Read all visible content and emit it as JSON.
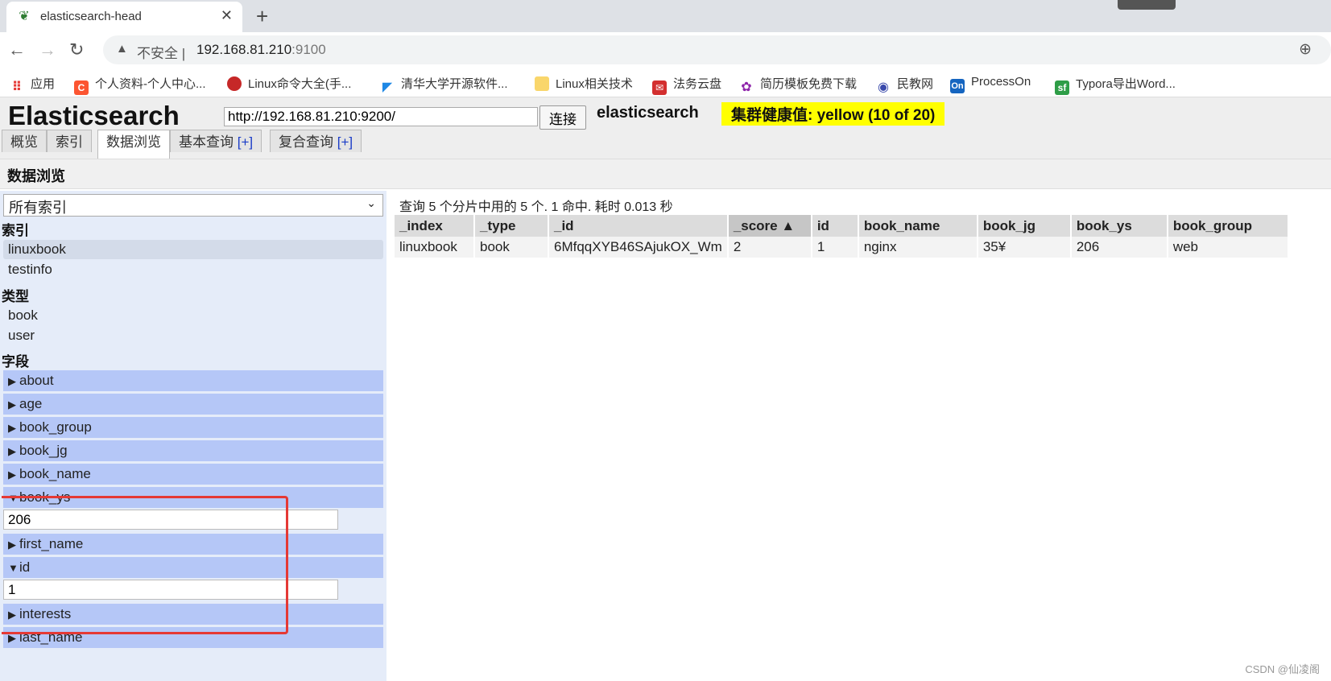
{
  "browser": {
    "tab_title": "elasticsearch-head",
    "security_label": "不安全",
    "url_host": "192.168.81.210",
    "url_port": ":9100",
    "bookmarks": [
      "应用",
      "个人资料-个人中心...",
      "Linux命令大全(手...",
      "清华大学开源软件...",
      "Linux相关技术",
      "法务云盘",
      "简历模板免费下载",
      "民教网",
      "ProcessOn",
      "Typora导出Word..."
    ]
  },
  "app": {
    "logo": "Elasticsearch",
    "connect_url": "http://192.168.81.210:9200/",
    "connect_label": "连接",
    "cluster_name": "elasticsearch",
    "health": "集群健康值: yellow (10 of 20)",
    "tabs": [
      {
        "label": "概览"
      },
      {
        "label": "索引"
      },
      {
        "label": "数据浏览"
      },
      {
        "label": "基本查询",
        "plus": "[+]"
      },
      {
        "label": "复合查询",
        "plus": "[+]"
      }
    ],
    "section_title": "数据浏览"
  },
  "sidebar": {
    "index_select": "所有索引",
    "indices_heading": "索引",
    "indices": [
      "linuxbook",
      "testinfo"
    ],
    "types_heading": "类型",
    "types": [
      "book",
      "user"
    ],
    "fields_heading": "字段",
    "fields": [
      "about",
      "age",
      "book_group",
      "book_jg",
      "book_name",
      "book_ys",
      "first_name",
      "id",
      "interests",
      "last_name"
    ],
    "book_ys_value": "206",
    "id_value": "1"
  },
  "results": {
    "summary": "查询 5 个分片中用的 5 个. 1 命中. 耗时 0.013 秒",
    "columns": [
      "_index",
      "_type",
      "_id",
      "_score ▲",
      "id",
      "book_name",
      "book_jg",
      "book_ys",
      "book_group"
    ],
    "rows": [
      [
        "linuxbook",
        "book",
        "6MfqqXYB46SAjukOX_Wm",
        "2",
        "1",
        "nginx",
        "35¥",
        "206",
        "web"
      ]
    ]
  },
  "watermark": "CSDN @仙凌阁",
  "colors": {
    "field_bg": "#b5c7f7",
    "sidebar_bg": "#e5ecf9",
    "health_bg": "#ffff00",
    "highlight_box": "#e53935"
  }
}
